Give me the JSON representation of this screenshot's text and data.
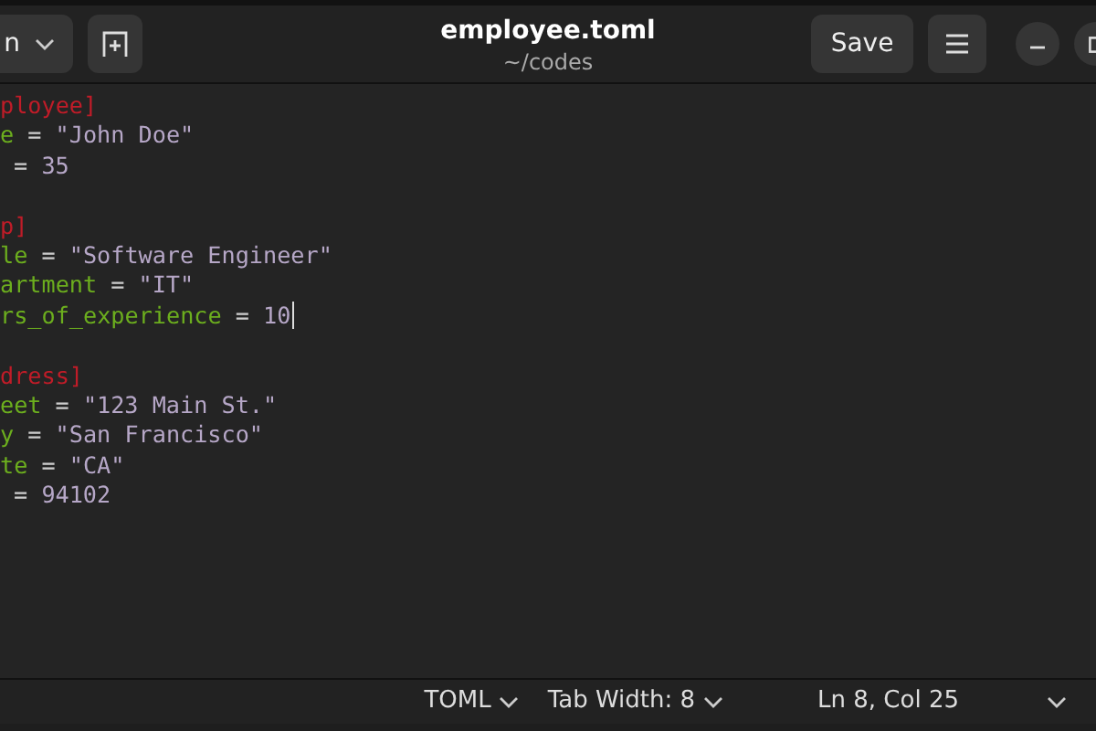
{
  "header": {
    "open_button": {
      "label": "n"
    },
    "title": "employee.toml",
    "subtitle": "~/codes",
    "save_button": "Save"
  },
  "lines": [
    {
      "kind": "header",
      "text": "ployee]",
      "cursor": false
    },
    {
      "kind": "pair",
      "key": "e",
      "op": "=",
      "value": "\"John Doe\"",
      "cursor": false
    },
    {
      "kind": "pair",
      "op": "=",
      "value": "35",
      "cursor": false
    },
    {
      "kind": "blank",
      "cursor": false
    },
    {
      "kind": "header",
      "text": "p]",
      "cursor": false
    },
    {
      "kind": "pair",
      "key": "le",
      "op": "=",
      "value": "\"Software Engineer\"",
      "cursor": false
    },
    {
      "kind": "pair",
      "key": "artment",
      "op": "=",
      "value": "\"IT\"",
      "cursor": false
    },
    {
      "kind": "pair",
      "key": "rs_of_experience",
      "op": "=",
      "value": "10",
      "cursor": true
    },
    {
      "kind": "blank",
      "cursor": false
    },
    {
      "kind": "header",
      "text": "dress]",
      "cursor": false
    },
    {
      "kind": "pair",
      "key": "eet",
      "op": "=",
      "value": "\"123 Main St.\"",
      "cursor": false
    },
    {
      "kind": "pair",
      "key": "y",
      "op": "=",
      "value": "\"San Francisco\"",
      "cursor": false
    },
    {
      "kind": "pair",
      "key": "te",
      "op": "=",
      "value": "\"CA\"",
      "cursor": false
    },
    {
      "kind": "pair",
      "op": "=",
      "value": "94102",
      "cursor": false
    }
  ],
  "status_bar": {
    "language": "TOML",
    "tab_width": "Tab Width: 8",
    "position": "Ln 8, Col 25"
  }
}
